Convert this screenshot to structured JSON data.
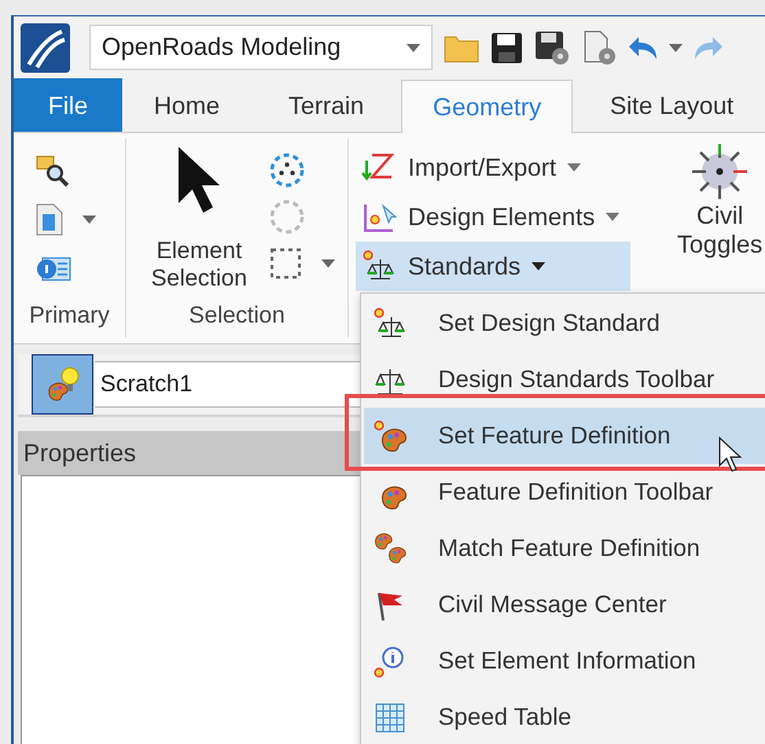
{
  "quick_access": {
    "workflow": "OpenRoads Modeling"
  },
  "tabs": [
    {
      "label": "File",
      "kind": "backstage",
      "selected": false
    },
    {
      "label": "Home",
      "kind": "tab",
      "selected": false
    },
    {
      "label": "Terrain",
      "kind": "tab",
      "selected": false
    },
    {
      "label": "Geometry",
      "kind": "tab",
      "selected": true
    },
    {
      "label": "Site Layout",
      "kind": "tab",
      "selected": false
    }
  ],
  "ribbon": {
    "primary_group": {
      "label": "Primary"
    },
    "selection_group": {
      "label": "Selection",
      "large_button": "Element Selection"
    },
    "geometry_buttons": [
      {
        "label": "Import/Export",
        "kind": "import",
        "expanded": false
      },
      {
        "label": "Design Elements",
        "kind": "design",
        "expanded": false
      },
      {
        "label": "Standards",
        "kind": "standards",
        "expanded": true
      }
    ],
    "civil_toggles": "Civil Toggles"
  },
  "model_toolbar": {
    "model": "Scratch1"
  },
  "properties_panel": {
    "title": "Properties"
  },
  "standards_menu": {
    "items": [
      {
        "label": "Set Design Standard",
        "kind": "standard",
        "selected": false
      },
      {
        "label": "Design Standards Toolbar",
        "kind": "scales",
        "selected": false
      },
      {
        "label": "Set Feature Definition",
        "kind": "feature",
        "selected": true
      },
      {
        "label": "Feature Definition Toolbar",
        "kind": "feature-toolbar",
        "selected": false
      },
      {
        "label": "Match Feature Definition",
        "kind": "match",
        "selected": false
      },
      {
        "label": "Civil Message Center",
        "kind": "flag",
        "selected": false
      },
      {
        "label": "Set Element Information",
        "kind": "info",
        "selected": false
      },
      {
        "label": "Speed Table",
        "kind": "table",
        "selected": false
      }
    ]
  }
}
